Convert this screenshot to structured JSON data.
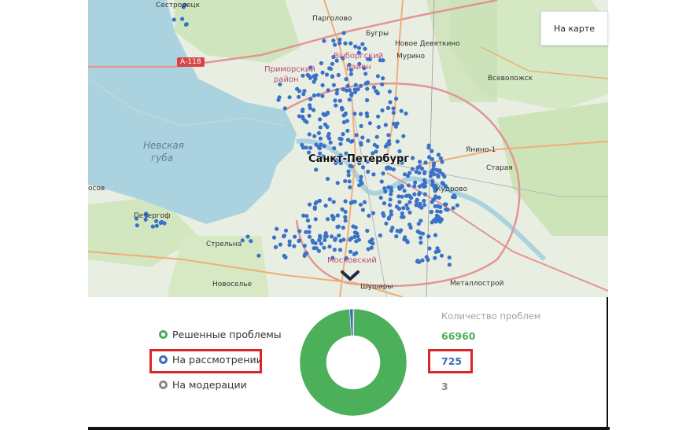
{
  "map": {
    "toggle_label": "На карте",
    "labels": {
      "sestroretsk": "Сестрорецк",
      "pargolovo": "Парголово",
      "bugry": "Бугры",
      "novoe_devyatkino": "Новое Девяткино",
      "murino": "Мурино",
      "primorsky": "Приморский",
      "rayon": "район",
      "vyborgsky": "Выборгский",
      "rayon2": "район",
      "vsevolozhsk": "Всеволожск",
      "nevskaya": "Невская",
      "guba": "губа",
      "spb": "Санкт-Петербург",
      "yanino": "Янино-1",
      "staraya": "Старая",
      "kudrovo": "Кудрово",
      "peterhof": "Петергоф",
      "strelna": "Стрельна",
      "novoselye": "Новоселье",
      "moskovsky": "Московский",
      "shushary": "Шушары",
      "metallostroy": "Металлострой",
      "kosos": "осов"
    },
    "road_shield": "А-118",
    "colors": {
      "water": "#aad3df",
      "land": "#e9eee2",
      "green": "#c8e2b5",
      "marker": "#3a72c9",
      "road_major": "#e69a9a",
      "road_orange": "#f2b27a"
    }
  },
  "legend": {
    "resolved": {
      "label": "Решенные проблемы",
      "color": "#4caf5a"
    },
    "review": {
      "label": "На рассмотрении",
      "color": "#3d6dbb"
    },
    "moderation": {
      "label": "На модерации",
      "color": "#8a8a8a"
    }
  },
  "counts": {
    "title": "Количество проблем",
    "resolved": "66960",
    "review": "725",
    "moderation": "3"
  },
  "chart_data": {
    "type": "pie",
    "categories": [
      "Решенные проблемы",
      "На рассмотрении",
      "На модерации"
    ],
    "values": [
      66960,
      725,
      3
    ],
    "colors": [
      "#4caf5a",
      "#3d6dbb",
      "#8a8a8a"
    ],
    "title": "",
    "donut": true
  }
}
